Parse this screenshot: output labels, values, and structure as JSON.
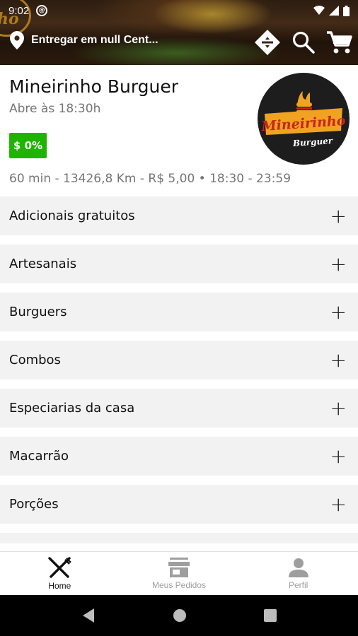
{
  "status_bar": {
    "time": "9:02"
  },
  "header": {
    "logo_text": "ho",
    "address": "Entregar em null Cent...",
    "icons": [
      "location-pin-icon",
      "compass-icon",
      "search-icon",
      "cart-icon"
    ]
  },
  "store": {
    "name": "Mineirinho Burguer",
    "opens": "Abre às 18:30h",
    "discount": "$ 0%",
    "meta": "60 min - 13426,8 Km - R$ 5,00 • 18:30 - 23:59",
    "logo_title": "Mineirinho",
    "logo_sub": "Burguer"
  },
  "categories": [
    {
      "label": "Adicionais gratuitos"
    },
    {
      "label": "Artesanais"
    },
    {
      "label": "Burguers"
    },
    {
      "label": "Combos"
    },
    {
      "label": "Especiarias da casa"
    },
    {
      "label": "Macarrão"
    },
    {
      "label": "Porções"
    }
  ],
  "bottom_nav": {
    "items": [
      {
        "label": "Home",
        "icon": "fork-knife-icon",
        "active": true
      },
      {
        "label": "Meus Pedidos",
        "icon": "store-icon",
        "active": false
      },
      {
        "label": "Perfil",
        "icon": "person-icon",
        "active": false
      }
    ]
  },
  "colors": {
    "discount": "#1fb400",
    "logo_red": "#c8261c",
    "logo_orange": "#f0a321"
  }
}
